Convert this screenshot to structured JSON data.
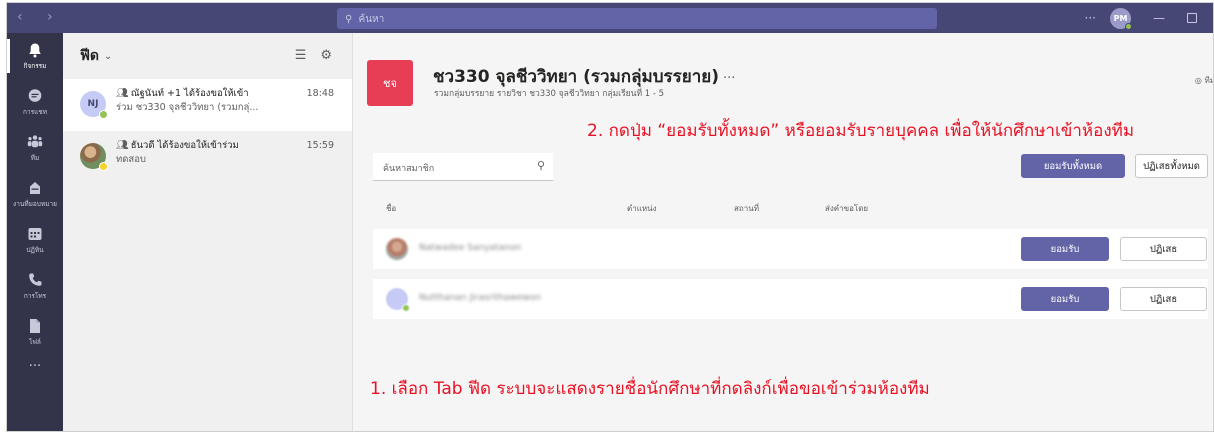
{
  "topbar": {
    "nav": "‹  ›",
    "search_placeholder": "ค้นหา",
    "more": "···",
    "avatar_initials": "PM",
    "minimize": "—"
  },
  "appbar": {
    "items": [
      {
        "label": "กิจกรรม",
        "icon": "bell-icon",
        "active": true
      },
      {
        "label": "การแชท",
        "icon": "chat-icon",
        "active": false
      },
      {
        "label": "ทีม",
        "icon": "teams-icon",
        "active": false
      },
      {
        "label": "งานที่มอบหมาย",
        "icon": "assignments-icon",
        "active": false
      },
      {
        "label": "ปฏิทิน",
        "icon": "calendar-icon",
        "active": false
      },
      {
        "label": "การโทร",
        "icon": "phone-icon",
        "active": false
      },
      {
        "label": "ไฟล์",
        "icon": "file-icon",
        "active": false
      }
    ],
    "more": "···"
  },
  "feed": {
    "title": "ฟีด",
    "chevron": "⌄",
    "filter_icon": "☰",
    "settings_icon": "⚙",
    "items": [
      {
        "initials": "NJ",
        "line1": "ณัฐนันท์ +1 ได้ร้องขอให้เข้า",
        "line2": "ร่วม ชว330 จุลชีววิทยา (รวมกลุ่...",
        "time": "18:48"
      },
      {
        "initials": "",
        "line1": "ธันวดี ได้ร้องขอให้เข้าร่วม",
        "line2": "ทดสอบ",
        "time": "15:59"
      }
    ]
  },
  "team": {
    "logo": "ชจ",
    "title": "ชว330 จุลชีววิทยา (รวมกลุ่มบรรยาย)",
    "title_more": "···",
    "subtitle": "รวมกลุ่มบรรยาย รายวิชา ชว330 จุลชีววิทยา กลุ่มเรียนที่ 1 - 5",
    "right_hint": "◎ ทีม"
  },
  "annotations": {
    "step2": "2. กดปุ่ม “ยอมรับทั้งหมด” หรือยอมรับรายบุคคล เพื่อให้นักศึกษาเข้าห้องทีม",
    "step1": "1. เลือก Tab ฟีด ระบบจะแสดงรายชื่อนักศึกษาที่กดลิงก์เพื่อขอเข้าร่วมห้องทีม"
  },
  "members": {
    "search_placeholder": "ค้นหาสมาชิก",
    "accept_all": "ยอมรับทั้งหมด",
    "reject_all": "ปฏิเสธทั้งหมด",
    "columns": [
      "ชื่อ",
      "ตำแหน่ง",
      "สถานที่",
      "ส่งคำขอโดย"
    ],
    "rows": [
      {
        "name": "Natwadee Sanyatanon",
        "accept": "ยอมรับ",
        "reject": "ปฏิเสธ"
      },
      {
        "name": "Nutthanan Jirasrithawewon",
        "accept": "ยอมรับ",
        "reject": "ปฏิเสธ"
      }
    ]
  },
  "colors": {
    "topbar": "#464775",
    "appbar": "#33344a",
    "accent": "#6264a7",
    "team_logo": "#e73e55",
    "annotation": "#e81123"
  }
}
